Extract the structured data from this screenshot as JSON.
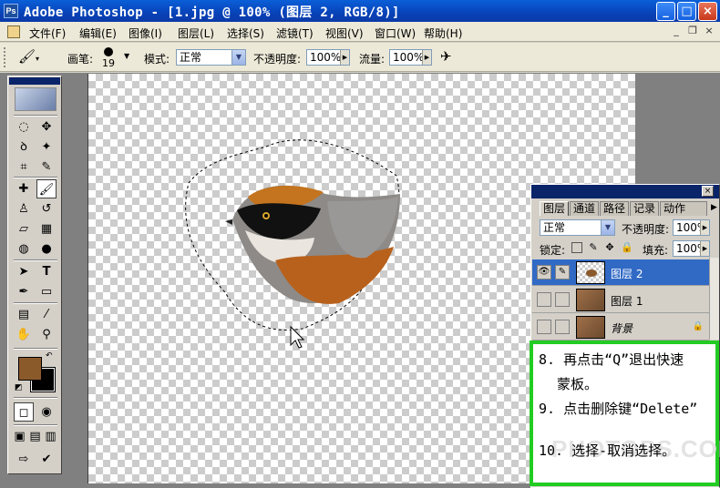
{
  "window": {
    "title": "Adobe Photoshop - [1.jpg @ 100% (图层 2, RGB/8)]",
    "app_logo": "Ps",
    "controls": {
      "minimize": "_",
      "maximize": "□",
      "close": "×"
    }
  },
  "menubar": {
    "items": [
      "文件(F)",
      "编辑(E)",
      "图像(I)",
      "图层(L)",
      "选择(S)",
      "滤镜(T)",
      "视图(V)",
      "窗口(W)",
      "帮助(H)"
    ],
    "doc_controls": {
      "minimize": "_",
      "restore": "❐",
      "close": "×"
    }
  },
  "options": {
    "tool_preset_icon": "brush-icon",
    "brush_label": "画笔:",
    "brush_size": "19",
    "mode_label": "模式:",
    "mode_value": "正常",
    "opacity_label": "不透明度:",
    "opacity_value": "100%",
    "flow_label": "流量:",
    "flow_value": "100%",
    "airbrush_icon": "airbrush-icon"
  },
  "toolbox": {
    "foreground_color": "#8b5a2b",
    "background_color": "#000000",
    "tools": [
      {
        "name": "marquee-tool",
        "glyph": "◌"
      },
      {
        "name": "move-tool",
        "glyph": "✥"
      },
      {
        "name": "lasso-tool",
        "glyph": "ꝺ"
      },
      {
        "name": "magic-wand-tool",
        "glyph": "✦"
      },
      {
        "name": "crop-tool",
        "glyph": "⌗"
      },
      {
        "name": "slice-tool",
        "glyph": "✎"
      },
      {
        "name": "healing-brush-tool",
        "glyph": "✚"
      },
      {
        "name": "brush-tool",
        "glyph": "🖌"
      },
      {
        "name": "clone-stamp-tool",
        "glyph": "♙"
      },
      {
        "name": "history-brush-tool",
        "glyph": "↺"
      },
      {
        "name": "eraser-tool",
        "glyph": "▱"
      },
      {
        "name": "gradient-tool",
        "glyph": "▦"
      },
      {
        "name": "blur-tool",
        "glyph": "◍"
      },
      {
        "name": "dodge-tool",
        "glyph": "●"
      },
      {
        "name": "path-selection-tool",
        "glyph": "➤"
      },
      {
        "name": "type-tool",
        "glyph": "T"
      },
      {
        "name": "pen-tool",
        "glyph": "✒"
      },
      {
        "name": "shape-tool",
        "glyph": "▭"
      },
      {
        "name": "notes-tool",
        "glyph": "▤"
      },
      {
        "name": "eyedropper-tool",
        "glyph": "⁄"
      },
      {
        "name": "hand-tool",
        "glyph": "✋"
      },
      {
        "name": "zoom-tool",
        "glyph": "⚲"
      }
    ]
  },
  "layers_panel": {
    "tabs": [
      "图层",
      "通道",
      "路径",
      "记录",
      "动作"
    ],
    "blend_mode": "正常",
    "opacity_label": "不透明度:",
    "opacity_value": "100%",
    "lock_label": "锁定:",
    "fill_label": "填充:",
    "fill_value": "100%",
    "layers": [
      {
        "name": "图层 2",
        "selected": true,
        "visible": true
      },
      {
        "name": "图层 1",
        "selected": false,
        "visible": false
      },
      {
        "name": "背景",
        "selected": false,
        "visible": false,
        "locked": true
      }
    ]
  },
  "instructions": {
    "step8_line1": "8. 再点击“Q”退出快速",
    "step8_line2": "蒙板。",
    "step9": "9. 点击删除键“Delete”",
    "step10": "10. 选择-取消选择。",
    "watermark": "PHOTOPS.COM"
  }
}
